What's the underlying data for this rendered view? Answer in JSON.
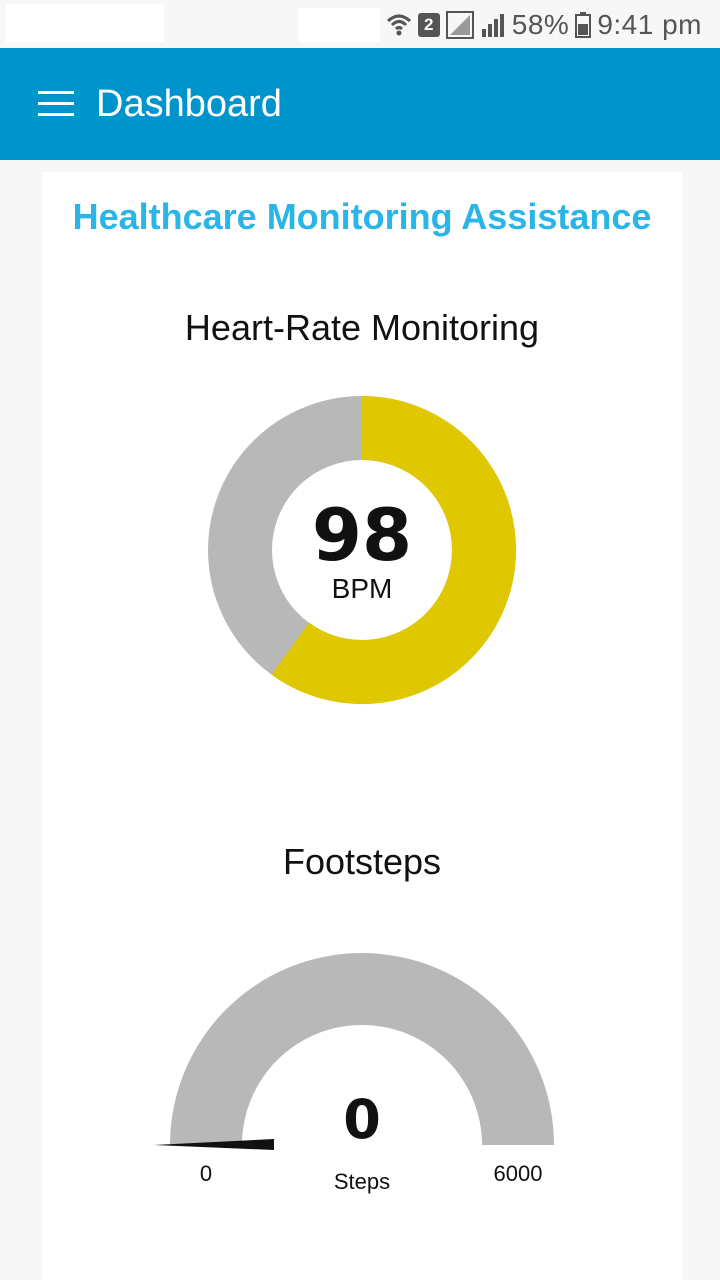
{
  "status_bar": {
    "battery": "58%",
    "time": "9:41 pm",
    "sim_slot": "2",
    "icons": [
      "wifi-icon",
      "sim-2-icon",
      "signal-icon",
      "signal-icon",
      "battery-icon"
    ]
  },
  "app_bar": {
    "title": "Dashboard",
    "menu_icon": "hamburger-menu-icon",
    "background": "#0094cc"
  },
  "card": {
    "header": "Healthcare Monitoring Assistance",
    "header_color": "#29b5e8"
  },
  "heart_rate": {
    "title": "Heart-Rate Monitoring",
    "value": "98",
    "unit": "BPM",
    "fill_fraction": 0.6,
    "fill_color": "#e0c800",
    "track_color": "#b8b8b8"
  },
  "footsteps": {
    "title": "Footsteps",
    "value": "0",
    "unit": "Steps",
    "min": "0",
    "max": "6000",
    "fill_fraction": 0,
    "track_color": "#b8b8b8",
    "needle_color": "#111111"
  }
}
